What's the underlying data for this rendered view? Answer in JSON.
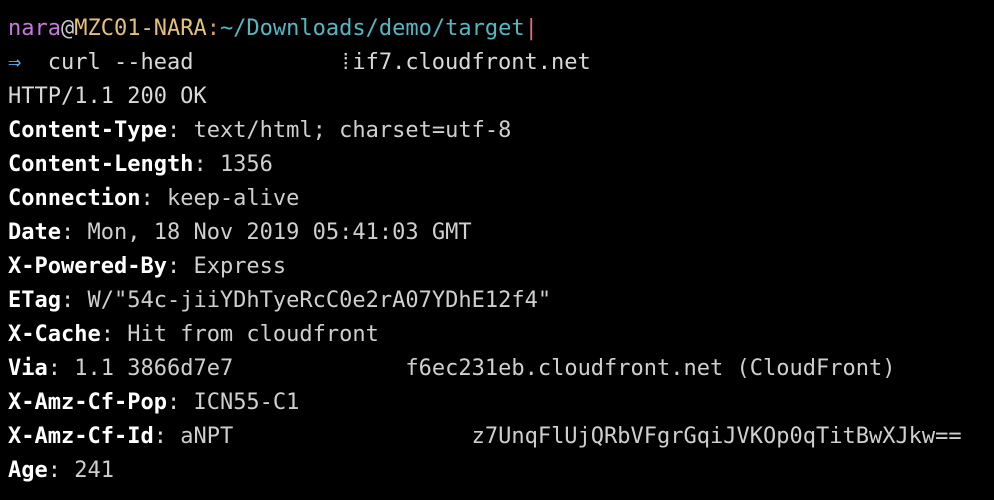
{
  "prompt": {
    "user": "nara",
    "at": "@",
    "host": "MZC01-NARA",
    "colon": ":",
    "path": "~/Downloads/demo/target",
    "cursor": "|"
  },
  "command": {
    "arrow": "⇒",
    "text": "  curl --head           ⁞if7.cloudfront.net"
  },
  "response": {
    "status_line": "HTTP/1.1 200 OK",
    "separator": ": ",
    "headers": [
      {
        "key": "Content-Type",
        "value": "text/html; charset=utf-8"
      },
      {
        "key": "Content-Length",
        "value": "1356"
      },
      {
        "key": "Connection",
        "value": "keep-alive"
      },
      {
        "key": "Date",
        "value": "Mon, 18 Nov 2019 05:41:03 GMT"
      },
      {
        "key": "X-Powered-By",
        "value": "Express"
      },
      {
        "key": "ETag",
        "value": "W/\"54c-jiiYDhTyeRcC0e2rA07YDhE12f4\""
      },
      {
        "key": "X-Cache",
        "value": "Hit from cloudfront"
      },
      {
        "key": "Via",
        "value": "1.1 3866d7e7             f6ec231eb.cloudfront.net (CloudFront)"
      },
      {
        "key": "X-Amz-Cf-Pop",
        "value": "ICN55-C1"
      },
      {
        "key": "X-Amz-Cf-Id",
        "value": "aNPT                  z7UnqFlUjQRbVFgrGqiJVKOp0qTitBwXJkw=="
      },
      {
        "key": "Age",
        "value": "241"
      }
    ]
  }
}
